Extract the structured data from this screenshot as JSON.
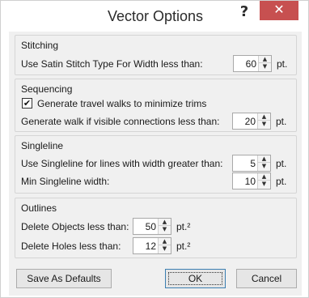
{
  "window": {
    "title": "Vector Options",
    "help_glyph": "?",
    "close_glyph": "✕",
    "close_color": "#c75050"
  },
  "stitching": {
    "title": "Stitching",
    "satin_label": "Use Satin Stitch Type For Width less than:",
    "satin_value": "60",
    "satin_unit": "pt."
  },
  "sequencing": {
    "title": "Sequencing",
    "travel_label": "Generate travel walks to minimize trims",
    "travel_checked": true,
    "travel_check_glyph": "✔",
    "walk_label": "Generate walk if visible connections less than:",
    "walk_value": "20",
    "walk_unit": "pt."
  },
  "singleline": {
    "title": "Singleline",
    "greater_label": "Use Singleline for lines with width greater than:",
    "greater_value": "5",
    "greater_unit": "pt.",
    "min_label": "Min Singleline width:",
    "min_value": "10",
    "min_unit": "pt."
  },
  "outlines": {
    "title": "Outlines",
    "objects_label": "Delete Objects less than:",
    "objects_value": "50",
    "objects_unit": "pt.²",
    "holes_label": "Delete Holes less than:",
    "holes_value": "12",
    "holes_unit": "pt.²"
  },
  "buttons": {
    "defaults": "Save As Defaults",
    "ok": "OK",
    "cancel": "Cancel"
  },
  "icons": {
    "spin_up": "▲",
    "spin_down": "▼"
  }
}
